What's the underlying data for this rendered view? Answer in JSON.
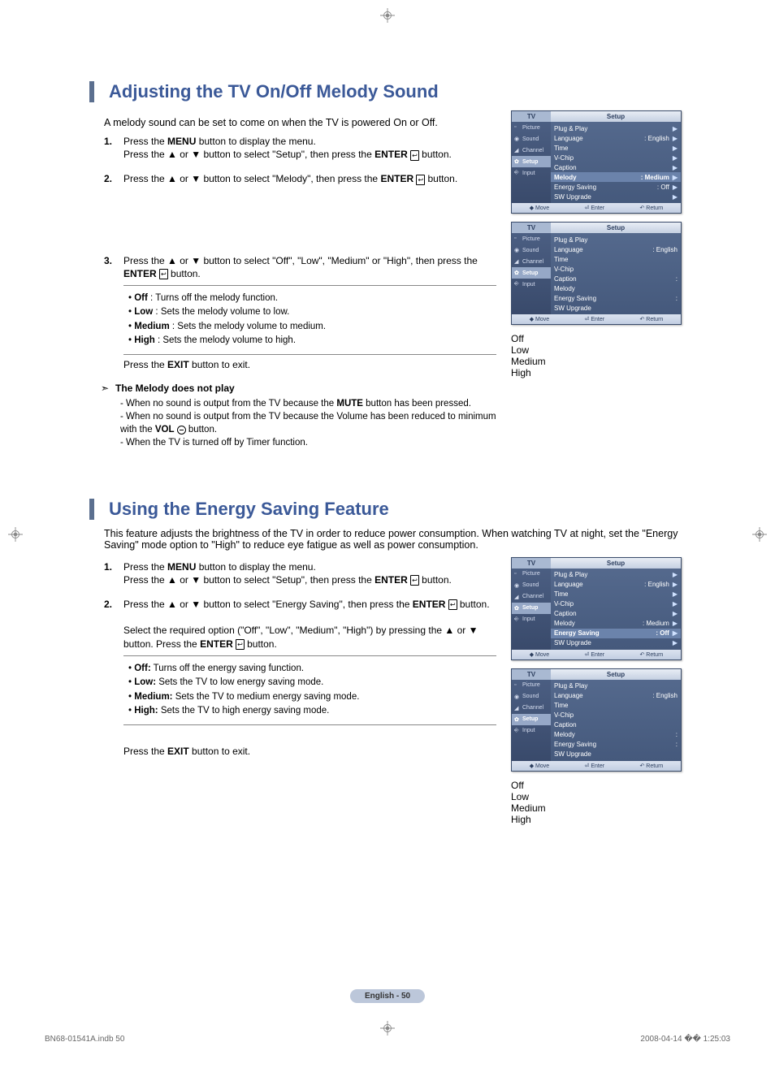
{
  "section1": {
    "title": "Adjusting the TV On/Off Melody Sound",
    "intro": "A melody sound can be set to come on when the TV is powered On or Off.",
    "steps": {
      "s1a": "Press the ",
      "s1b": "MENU",
      "s1c": " button to display the menu.",
      "s1d": "Press the ▲ or ▼ button to select \"Setup\", then press the ",
      "s1e": "ENTER",
      "s1f": " button.",
      "s2a": "Press the ▲ or ▼ button to select \"Melody\", then press the ",
      "s2b": "ENTER",
      "s2c": " button.",
      "s3a": "Press the ▲ or ▼ button to select \"Off\", \"Low\", \"Medium\" or \"High\", then press the ",
      "s3b": "ENTER",
      "s3c": " button."
    },
    "opts": {
      "off_l": "Off",
      "off_t": " : Turns off the melody function.",
      "low_l": "Low",
      "low_t": " : Sets the melody volume to low.",
      "med_l": "Medium",
      "med_t": " : Sets the melody volume to medium.",
      "high_l": "High",
      "high_t": " : Sets the melody volume to high."
    },
    "exit_a": "Press the ",
    "exit_b": "EXIT",
    "exit_c": " button to exit.",
    "note_title": "The Melody does not play",
    "note1a": "- When no sound is output from the TV because the ",
    "note1b": "MUTE",
    "note1c": " button has been pressed.",
    "note2a": "- When no sound is output from the TV because the Volume has been reduced to minimum with the ",
    "note2b": "VOL",
    "note2c": " button.",
    "note3": "- When the TV is turned off by Timer function."
  },
  "section2": {
    "title": "Using the Energy Saving Feature",
    "intro": "This feature adjusts the brightness of the TV in order to reduce power consumption. When watching TV at night, set the \"Energy Saving\" mode option to \"High\" to reduce eye fatigue as well as power consumption.",
    "steps": {
      "s1a": "Press the ",
      "s1b": "MENU",
      "s1c": " button to display the menu.",
      "s1d": "Press the ▲ or ▼ button to select \"Setup\", then press the ",
      "s1e": "ENTER",
      "s1f": " button.",
      "s2a": "Press the ▲ or ▼ button to select \"Energy Saving\", then press the ",
      "s2b": "ENTER",
      "s2c": " button.",
      "s2d": "Select the required option (\"Off\", \"Low\", \"Medium\", \"High\") by pressing the ▲ or ▼ button. Press the ",
      "s2e": "ENTER",
      "s2f": " button."
    },
    "opts": {
      "off_l": "Off:",
      "off_t": " Turns off the energy saving function.",
      "low_l": "Low:",
      "low_t": " Sets the TV to low energy saving mode.",
      "med_l": "Medium:",
      "med_t": " Sets the TV to medium energy saving mode.",
      "high_l": "High:",
      "high_t": " Sets the TV to high energy saving mode."
    },
    "exit_a": "Press the ",
    "exit_b": "EXIT",
    "exit_c": " button to exit."
  },
  "osd": {
    "tv": "TV",
    "setup": "Setup",
    "side": {
      "picture": "Picture",
      "sound": "Sound",
      "channel": "Channel",
      "setup_l": "Setup",
      "input": "Input"
    },
    "menu": {
      "plug": "Plug & Play",
      "lang": "Language",
      "lang_v": ": English",
      "time": "Time",
      "vchip": "V-Chip",
      "caption": "Caption",
      "melody": "Melody",
      "melody_v": ": Medium",
      "energy": "Energy Saving",
      "energy_v": ": Off",
      "sw": "SW Upgrade"
    },
    "popup": {
      "off": "Off",
      "low": "Low",
      "medium": "Medium",
      "high": "High"
    },
    "footer": {
      "move": "Move",
      "enter": "Enter",
      "return": "Return"
    }
  },
  "page_num": "English - 50",
  "footer_left": "BN68-01541A.indb   50",
  "footer_right": "2008-04-14   �� 1:25:03"
}
